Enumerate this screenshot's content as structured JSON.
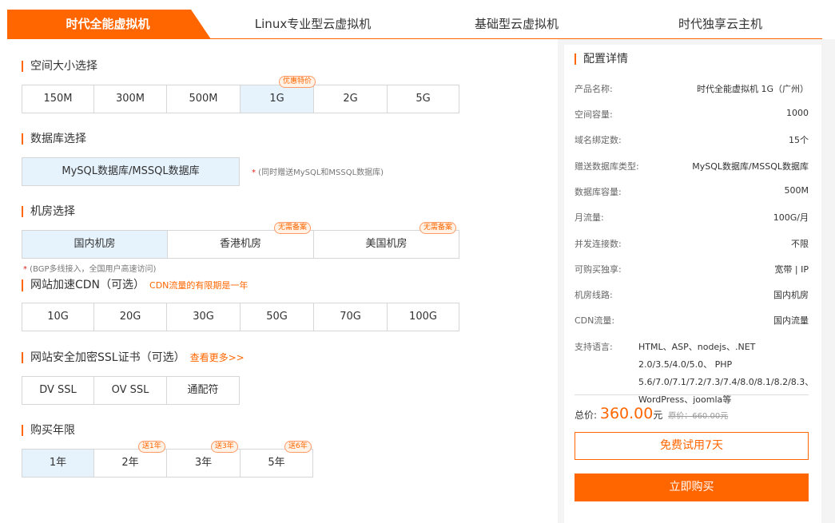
{
  "tabs": [
    "时代全能虚拟机",
    "Linux专业型云虚拟机",
    "基础型云虚拟机",
    "时代独享云主机"
  ],
  "colors": {
    "accent": "#ff6600",
    "selected_bg": "#e6f3fd"
  },
  "space": {
    "title": "空间大小选择",
    "options": [
      "150M",
      "300M",
      "500M",
      "1G",
      "2G",
      "5G"
    ],
    "selected": "1G",
    "badge": "优惠特价"
  },
  "database": {
    "title": "数据库选择",
    "option": "MySQL数据库/MSSQL数据库",
    "hint_star": "*",
    "hint": " (同时赠送MySQL和MSSQL数据库)"
  },
  "room": {
    "title": "机房选择",
    "options": [
      "国内机房",
      "香港机房",
      "美国机房"
    ],
    "selected": "国内机房",
    "badges": [
      "无需备案",
      "无需备案"
    ],
    "hint_star": "*",
    "hint": " (BGP多线接入，全国用户高速访问)"
  },
  "cdn": {
    "title": "网站加速CDN（可选）",
    "note": "CDN流量的有限期是一年",
    "options": [
      "10G",
      "20G",
      "30G",
      "50G",
      "70G",
      "100G"
    ]
  },
  "ssl": {
    "title": "网站安全加密SSL证书（可选）",
    "link": "查看更多>>",
    "options": [
      "DV SSL",
      "OV SSL",
      "通配符"
    ]
  },
  "years": {
    "title": "购买年限",
    "options": [
      "1年",
      "2年",
      "3年",
      "5年"
    ],
    "selected": "1年",
    "badges": [
      "送1年",
      "送3年",
      "送6年"
    ]
  },
  "config": {
    "title": "配置详情",
    "rows": [
      {
        "k": "产品名称:",
        "v": "时代全能虚拟机 1G（广州）"
      },
      {
        "k": "空间容量:",
        "v": "1000"
      },
      {
        "k": "域名绑定数:",
        "v": "15个"
      },
      {
        "k": "赠送数据库类型:",
        "v": "MySQL数据库/MSSQL数据库"
      },
      {
        "k": "数据库容量:",
        "v": "500M"
      },
      {
        "k": "月流量:",
        "v": "100G/月"
      },
      {
        "k": "并发连接数:",
        "v": "不限"
      },
      {
        "k": "可购买独享:",
        "v": "宽带 | IP"
      },
      {
        "k": "机房线路:",
        "v": "国内机房"
      },
      {
        "k": "CDN流量:",
        "v": "国内流量"
      }
    ],
    "lang_label": "支持语言:",
    "lang_value": "HTML、ASP、nodejs、.NET 2.0/3.5/4.0/5.0、 PHP 5.6/7.0/7.1/7.2/7.3/7.4/8.0/8.1/8.2/8.3、 WordPress、joomla等"
  },
  "price": {
    "label": "总价:",
    "amount": "360.00",
    "unit": "元",
    "original": "原价：660.00元"
  },
  "buttons": {
    "trial": "免费试用7天",
    "buy": "立即购买"
  }
}
